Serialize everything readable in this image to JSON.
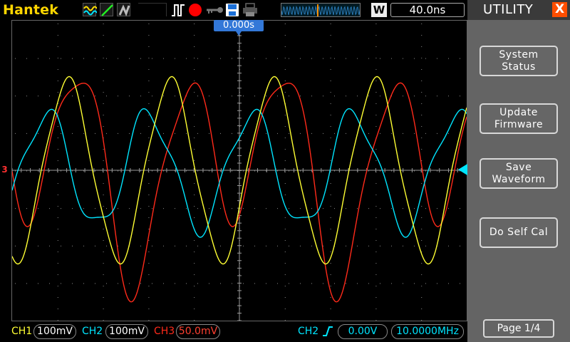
{
  "header": {
    "brand": "Hantek",
    "timebase_mode": "W",
    "timebase_value": "40.0ns"
  },
  "trigger_position": "0.000s",
  "channel3_marker": "3",
  "channels": [
    {
      "label": "CH1",
      "scale": "100mV",
      "color": "#ffff33"
    },
    {
      "label": "CH2",
      "scale": "100mV",
      "color": "#00e5ff"
    },
    {
      "label": "CH3",
      "scale": "50.0mV",
      "color": "#ff2a1a"
    }
  ],
  "trigger": {
    "source": "CH2",
    "level": "0.00V",
    "frequency": "10.0000MHz"
  },
  "menu": {
    "title": "UTILITY",
    "close": "X",
    "buttons": [
      {
        "line1": "System",
        "line2": "Status"
      },
      {
        "line1": "Update",
        "line2": "Firmware"
      },
      {
        "line1": "Save",
        "line2": "Waveform"
      },
      {
        "line1": "Do Self Cal",
        "line2": ""
      }
    ],
    "page": "Page 1/4"
  },
  "icons": {
    "mode_icons": [
      "wave-mode-icon",
      "line-mode-icon",
      "persist-mode-icon"
    ],
    "run_icon": "pulse-icon",
    "record": "record-icon",
    "lock": "key-icon",
    "save": "save-icon",
    "print": "print-icon"
  }
}
